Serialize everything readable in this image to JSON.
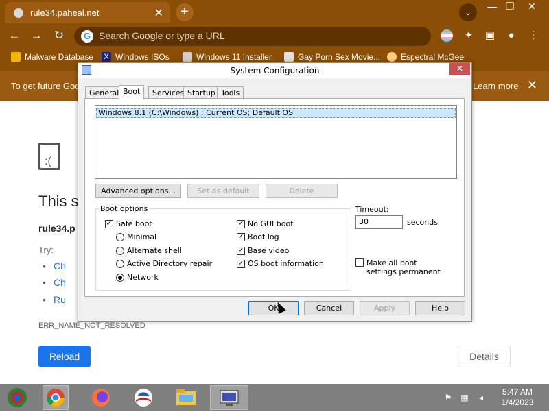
{
  "browser": {
    "tab_title": "rule34.paheal.net",
    "omnibox_placeholder": "Search Google or type a URL",
    "theme_color": "#8a4e06",
    "bookmarks": [
      {
        "label": "Malware Database"
      },
      {
        "label": "Windows ISOs"
      },
      {
        "label": "Windows 11 Installer"
      },
      {
        "label": "Gay Porn Sex Movie..."
      },
      {
        "label": "Espectral McGee"
      }
    ],
    "infobar": {
      "text": "To get future Goo",
      "learn_more": "Learn more"
    }
  },
  "error_page": {
    "title": "This si",
    "host": "rule34.p",
    "try_label": "Try:",
    "suggestions": [
      "Ch",
      "Ch",
      "Ru"
    ],
    "error_code": "ERR_NAME_NOT_RESOLVED",
    "reload_label": "Reload",
    "details_label": "Details"
  },
  "dialog": {
    "title": "System Configuration",
    "close_glyph": "✕",
    "tabs": [
      "General",
      "Boot",
      "Services",
      "Startup",
      "Tools"
    ],
    "active_tab": "Boot",
    "os_entry": "Windows 8.1 (C:\\Windows) : Current OS; Default OS",
    "advanced_options_label": "Advanced options...",
    "set_default_label": "Set as default",
    "delete_label": "Delete",
    "boot_options_label": "Boot options",
    "safe_boot": {
      "label": "Safe boot",
      "checked": true
    },
    "safe_boot_modes": [
      {
        "label": "Minimal",
        "selected": false
      },
      {
        "label": "Alternate shell",
        "selected": false
      },
      {
        "label": "Active Directory repair",
        "selected": false
      },
      {
        "label": "Network",
        "selected": true
      }
    ],
    "right_options": [
      {
        "label": "No GUI boot",
        "checked": true
      },
      {
        "label": "Boot log",
        "checked": true
      },
      {
        "label": "Base video",
        "checked": true
      },
      {
        "label": "OS boot information",
        "checked": true
      }
    ],
    "timeout_label": "Timeout:",
    "timeout_value": "30",
    "seconds_label": "seconds",
    "make_permanent_label": "Make all boot settings permanent",
    "ok_label": "OK",
    "cancel_label": "Cancel",
    "apply_label": "Apply",
    "help_label": "Help"
  },
  "taskbar": {
    "time": "5:47 AM",
    "date": "1/4/2023",
    "color": "#7f7f7f"
  }
}
